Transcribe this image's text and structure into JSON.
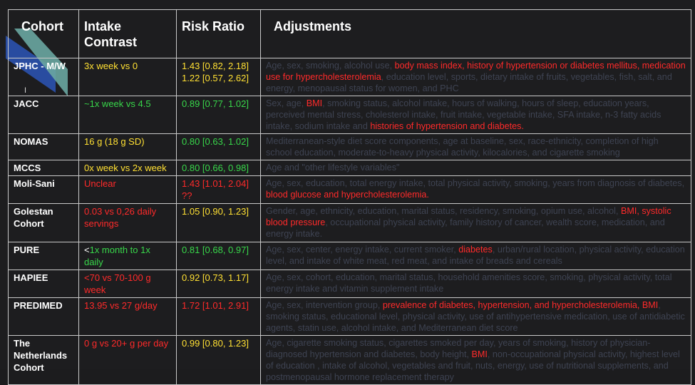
{
  "headers": {
    "cohort": "Cohort",
    "intake": "Intake Contrast",
    "risk": "Risk Ratio",
    "adjustments": "Adjustments"
  },
  "colors": {
    "yellow": "#ffe033",
    "green": "#38d74a",
    "red": "#ff2a2a",
    "muted": "#3e4352"
  },
  "rows": [
    {
      "cohort": "JPHC - M/W",
      "intake": "3x week vs 0",
      "intake_color": "yellow",
      "risk": [
        "1.43 [0.82, 2.18]",
        "1.22 [0.57, 2.62]"
      ],
      "risk_color": "yellow",
      "adj": [
        {
          "t": "Age, sex, smoking, alcohol use, ",
          "h": false
        },
        {
          "t": "body mass index, history of hypertension or diabetes mellitus, medication use for hypercholesterolemia",
          "h": true
        },
        {
          "t": ", education level, sports, dietary intake of fruits, vegetables, fish, salt, and energy, menopausal status for women, and PHC",
          "h": false
        }
      ]
    },
    {
      "cohort": "JACC",
      "intake": "~1x week vs 4.5",
      "intake_color": "green",
      "risk": [
        "0.89 [0.77, 1.02]"
      ],
      "risk_color": "green",
      "adj": [
        {
          "t": "Sex, age, ",
          "h": false
        },
        {
          "t": "BMI",
          "h": true
        },
        {
          "t": ", smoking status, alcohol intake, hours of walking, hours of sleep, education years, perceived mental stress, cholesterol intake, fruit intake, vegetable intake, SFA intake, n-3 fatty acids intake, sodium intake and ",
          "h": false
        },
        {
          "t": "histories of hypertension and diabetes.",
          "h": true
        }
      ]
    },
    {
      "cohort": "NOMAS",
      "intake": "16 g (18 g SD)",
      "intake_color": "yellow",
      "risk": [
        "0.80 [0.63, 1.02]"
      ],
      "risk_color": "green",
      "adj": [
        {
          "t": "Mediterranean-style diet score components, age at baseline, sex, race-ethnicity, completion of high school education, moderate-to-heavy physical activity, kilocalories, and cigarette smoking",
          "h": false
        }
      ]
    },
    {
      "cohort": "MCCS",
      "intake": "0x week vs 2x week",
      "intake_color": "yellow",
      "risk": [
        "0.80 [0.66, 0.98]"
      ],
      "risk_color": "green",
      "adj": [
        {
          "t": "Age and \"other lifestyle variables\"",
          "h": false
        }
      ]
    },
    {
      "cohort": "Moli-Sani",
      "intake": "Unclear",
      "intake_color": "red",
      "risk": [
        "1.43 [1.01, 2.04]",
        "??"
      ],
      "risk_color": "red",
      "adj": [
        {
          "t": "Age, sex, education, total energy intake, total physical activity, smoking, years from diagnosis of diabetes, ",
          "h": false
        },
        {
          "t": "blood glucose and hypercholesterolemia.",
          "h": true
        }
      ]
    },
    {
      "cohort": "Golestan Cohort",
      "intake": "0.03 vs 0,26 daily servings",
      "intake_color": "red",
      "risk": [
        "1.05 [0.90, 1.23]"
      ],
      "risk_color": "yellow",
      "adj": [
        {
          "t": "Gender, age, ethnicity, education, marital status, residency,  smoking, opium use, alcohol, ",
          "h": false
        },
        {
          "t": "BMI, systolic blood pressure",
          "h": true
        },
        {
          "t": ", occupational physical activity, family history of cancer, wealth score, medication, and energy intake.",
          "h": false
        }
      ]
    },
    {
      "cohort": "PURE",
      "intake_parts": [
        {
          "t": "<",
          "c": "white"
        },
        {
          "t": "1x month to 1x daily",
          "c": "green"
        }
      ],
      "risk": [
        "0.81 [0.68, 0.97]"
      ],
      "risk_color": "green",
      "adj": [
        {
          "t": "Age, sex, center, energy intake, current smoker, ",
          "h": false
        },
        {
          "t": "diabetes",
          "h": true
        },
        {
          "t": ", urban/rural location, physical activity, education level, and intake of white meat, red meat, and intake of breads and cereals",
          "h": false
        }
      ]
    },
    {
      "cohort": "HAPIEE",
      "intake": "<70 vs 70-100 g week",
      "intake_color": "red",
      "risk": [
        "0.92 [0.73, 1.17]"
      ],
      "risk_color": "yellow",
      "adj": [
        {
          "t": "Age, sex, cohort, education, marital status, household amenities score, smoking, physical activity, total energy intake and vitamin supplement intake",
          "h": false
        }
      ]
    },
    {
      "cohort": "PREDIMED",
      "intake": "13.95  vs 27 g/day",
      "intake_color": "red",
      "risk": [
        "1.72 [1.01, 2.91]"
      ],
      "risk_color": "red",
      "adj": [
        {
          "t": "Age, sex, intervention group, ",
          "h": false
        },
        {
          "t": "prevalence of diabetes, hypertension, and hypercholesterolemia, BMI",
          "h": true
        },
        {
          "t": ", smoking status, educational level, physical activity, use of antihypertensive medication, use of antidiabetic agents, statin use, alcohol intake, and Mediterranean diet score",
          "h": false
        }
      ]
    },
    {
      "cohort": "The Netherlands Cohort",
      "intake": "0 g vs 20+ g per day",
      "intake_color": "red",
      "risk": [
        "0.99 [0.80, 1.23]"
      ],
      "risk_color": "yellow",
      "adj": [
        {
          "t": "Age, cigarette smoking status, cigarettes smoked per day, years of smoking, history of physician-diagnosed hypertension and diabetes, body height, ",
          "h": false
        },
        {
          "t": "BMI",
          "h": true
        },
        {
          "t": ", non-occupational physical activity, highest level of education , intake of alcohol, vegetables and fruit, nuts, energy, use of nutritional supplements, and postmenopausal hormone replacement therapy",
          "h": false
        }
      ]
    }
  ]
}
